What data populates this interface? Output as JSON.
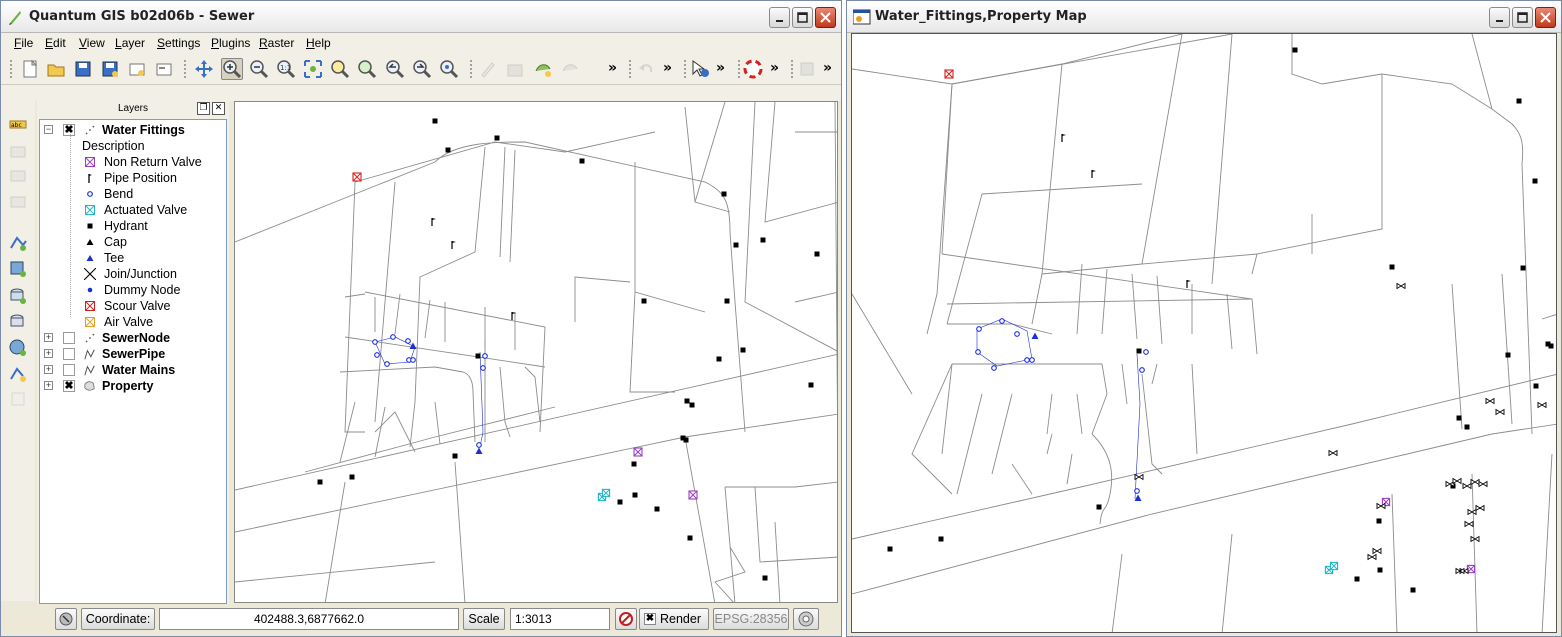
{
  "qgis": {
    "title": "Quantum GIS b02d06b - Sewer",
    "menu": [
      "File",
      "Edit",
      "View",
      "Layer",
      "Settings",
      "Plugins",
      "Raster",
      "Help"
    ],
    "menu_mnemonic": [
      "F",
      "E",
      "V",
      "L",
      "S",
      "P",
      "R",
      "H"
    ],
    "overflow": "»",
    "layers_panel": {
      "title": "Layers",
      "layers": [
        {
          "name": "Water Fittings",
          "checked": true,
          "expanded": true
        },
        {
          "name": "SewerNode",
          "checked": false,
          "expanded": false
        },
        {
          "name": "SewerPipe",
          "checked": false,
          "expanded": false
        },
        {
          "name": "Water Mains",
          "checked": false,
          "expanded": false
        },
        {
          "name": "Property",
          "checked": true,
          "expanded": false
        }
      ],
      "legend_header": "Description",
      "legend": [
        {
          "label": "Non Return Valve",
          "icon": "box-x-icon",
          "color": "#9a3fbf"
        },
        {
          "label": "Pipe Position",
          "icon": "flag-icon",
          "color": "#000000"
        },
        {
          "label": "Bend",
          "icon": "circle-icon",
          "color": "#1a2fd6"
        },
        {
          "label": "Actuated Valve",
          "icon": "box-x-icon",
          "color": "#1fb7c9"
        },
        {
          "label": "Hydrant",
          "icon": "square-icon",
          "color": "#000000"
        },
        {
          "label": "Cap",
          "icon": "triangle-icon",
          "color": "#000000"
        },
        {
          "label": "Tee",
          "icon": "triangle-icon",
          "color": "#1a2fd6"
        },
        {
          "label": "Join/Junction",
          "icon": "cross-icon",
          "color": "#000000"
        },
        {
          "label": "Dummy Node",
          "icon": "dot-icon",
          "color": "#1a2fd6"
        },
        {
          "label": "Scour Valve",
          "icon": "box-x-icon",
          "color": "#d62020"
        },
        {
          "label": "Air Valve",
          "icon": "box-x-icon",
          "color": "#e8a020"
        }
      ]
    },
    "status": {
      "coordinate_label": "Coordinate:",
      "coordinate_value": "402488.3,6877662.0",
      "scale_label": "Scale",
      "scale_value": "1:3013",
      "render_label": "Render",
      "render_checked": true,
      "crs": "EPSG:28356"
    }
  },
  "map_window": {
    "title": "Water_Fittings,Property Map"
  },
  "colors": {
    "title_bg": "#f0f0f0",
    "close_button": "#c0391e",
    "parcel_line": "#8c8c8c",
    "bend_blue": "#1a2fd6",
    "scour_red": "#d62020",
    "actuated_cyan": "#1fb7c9",
    "nonreturn_purple": "#9a3fbf"
  }
}
